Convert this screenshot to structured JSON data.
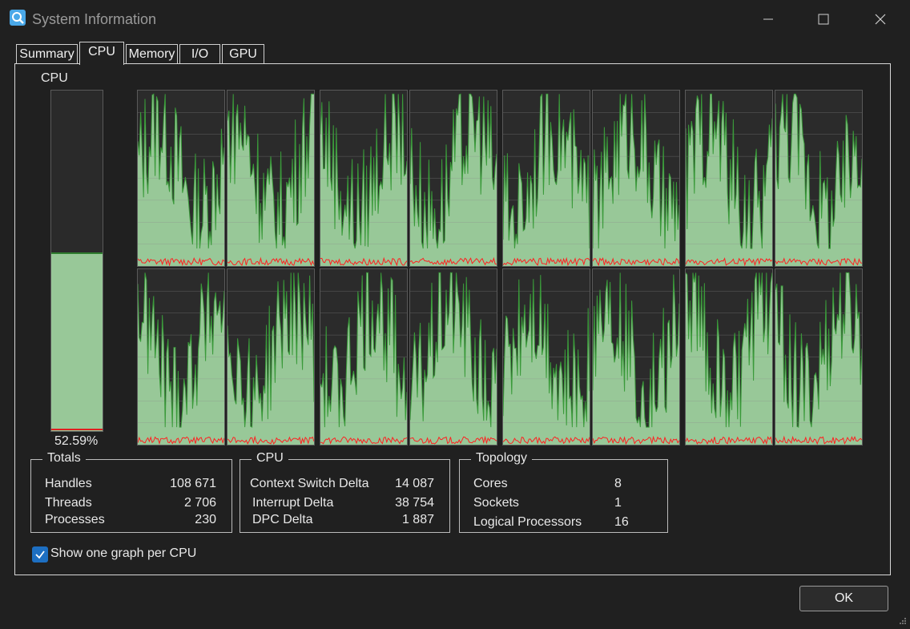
{
  "window": {
    "title": "System Information",
    "icon": "system-info-icon"
  },
  "tabs": [
    {
      "label": "Summary",
      "active": false
    },
    {
      "label": "CPU",
      "active": true
    },
    {
      "label": "Memory",
      "active": false
    },
    {
      "label": "I/O",
      "active": false
    },
    {
      "label": "GPU",
      "active": false
    }
  ],
  "cpu_overall": {
    "label": "CPU",
    "percent_text": "52.59%",
    "value": 52.59
  },
  "graphs": {
    "count": 16,
    "grid_lines": true,
    "usage_color": "#98c898",
    "line_color": "#3a9a3a",
    "kernel_color": "#ff2020"
  },
  "totals": {
    "title": "Totals",
    "rows": [
      {
        "label": "Handles",
        "value": "108 671"
      },
      {
        "label": "Threads",
        "value": "2 706"
      },
      {
        "label": "Processes",
        "value": "230"
      }
    ]
  },
  "cpu_stats": {
    "title": "CPU",
    "rows": [
      {
        "label": "Context Switch Delta",
        "value": "14 087"
      },
      {
        "label": "Interrupt Delta",
        "value": "38 754"
      },
      {
        "label": "DPC Delta",
        "value": "1 887"
      }
    ]
  },
  "topology": {
    "title": "Topology",
    "rows": [
      {
        "label": "Cores",
        "value": "8"
      },
      {
        "label": "Sockets",
        "value": "1"
      },
      {
        "label": "Logical Processors",
        "value": "16"
      }
    ]
  },
  "options": {
    "show_one_graph_label": "Show one graph per CPU",
    "checked": true
  },
  "buttons": {
    "ok": "OK"
  },
  "colors": {
    "accent": "#1d6fc2",
    "background": "#202020"
  }
}
